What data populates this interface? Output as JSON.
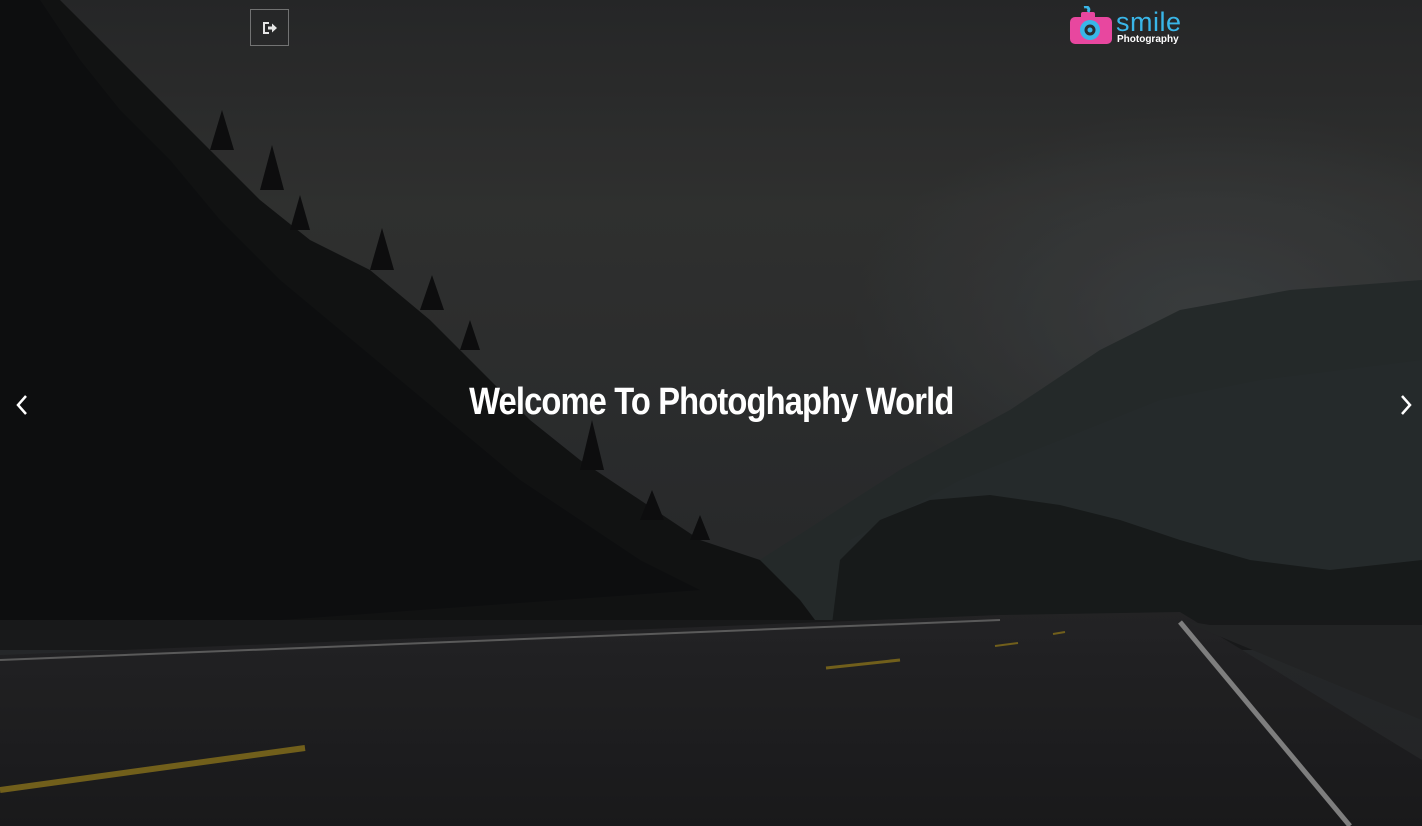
{
  "header": {
    "logout_icon": "sign-out-icon",
    "logo": {
      "word": "smile",
      "sub": "Photography",
      "camera_icon": "camera-icon",
      "colors": {
        "camera": "#e8479f",
        "lens": "#39b6e8",
        "word": "#39b6e8"
      }
    }
  },
  "carousel": {
    "headline": "Welcome To Photoghaphy World",
    "prev_icon": "chevron-left-icon",
    "next_icon": "chevron-right-icon"
  }
}
